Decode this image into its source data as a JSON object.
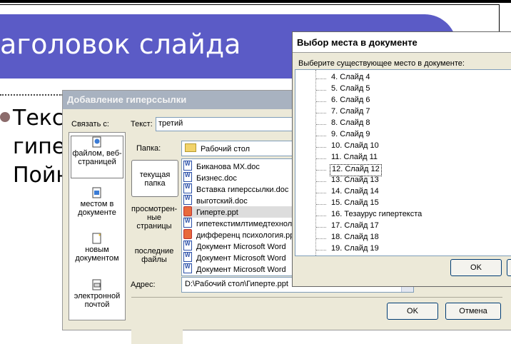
{
  "slide": {
    "title": "аголовок слайда",
    "body_lines": [
      "Текс",
      "гипе",
      "Пойн"
    ]
  },
  "hyperlink_dialog": {
    "title": "Добавление гиперссылки",
    "link_to_label": "Связать с:",
    "text_label": "Текст:",
    "text_value": "третий",
    "folder_label": "Папка:",
    "folder_value": "Рабочий стол",
    "address_label": "Адрес:",
    "address_value": "D:\\Рабочий стол\\Гиперте.ppt",
    "link_types": [
      {
        "label": "файлом, веб-страницей",
        "icon": "web-page-icon"
      },
      {
        "label": "местом в документе",
        "icon": "place-in-document-icon"
      },
      {
        "label": "новым документом",
        "icon": "new-document-icon"
      },
      {
        "label": "электронной почтой",
        "icon": "email-icon"
      }
    ],
    "browse_tabs": [
      "текущая папка",
      "просмотрен-ные страницы",
      "последние файлы"
    ],
    "files": [
      "Биканова MX.doc",
      "Бизнес.doc",
      "Вставка гиперссылки.doc",
      "выготский.doc",
      "Гиперте.ppt",
      "гипетекстимлтимедтехнол",
      "дифференц психология.ppt",
      "Документ Microsoft Word",
      "Документ Microsoft Word",
      "Документ Microsoft Word"
    ],
    "ok_label": "OK",
    "cancel_label": "Отмена"
  },
  "place_dialog": {
    "title": "Выбор места в документе",
    "prompt": "Выберите существующее место в документе:",
    "items": [
      "4. Слайд 4",
      "5. Слайд 5",
      "6. Слайд 6",
      "7. Слайд 7",
      "8. Слайд 8",
      "9. Слайд 9",
      "10. Слайд 10",
      "11. Слайд 11",
      "12. Слайд 12",
      "13. Слайд 13",
      "14. Слайд 14",
      "15. Слайд 15",
      "16. Тезаурус гипертекста",
      "17. Слайд 17",
      "18. Слайд 18",
      "19. Слайд 19"
    ],
    "selected_index": 8,
    "ok_label": "OK"
  }
}
